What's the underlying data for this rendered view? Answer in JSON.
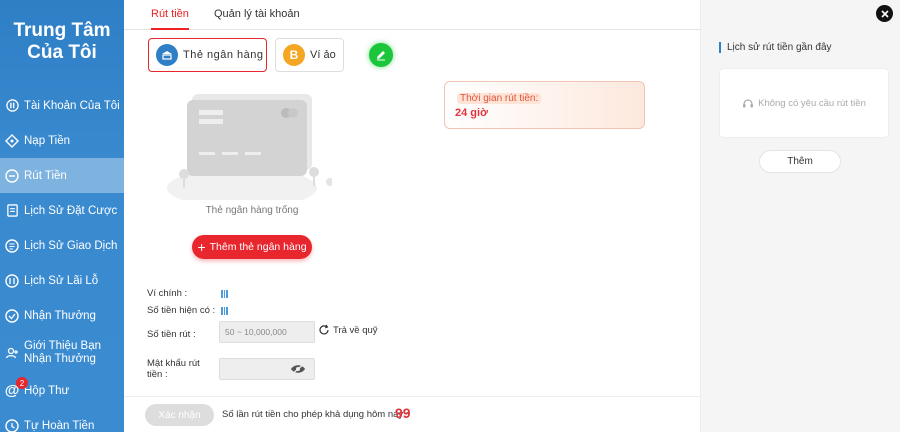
{
  "sidebar": {
    "title_line1": "Trung Tâm",
    "title_line2": "Của Tôi",
    "items": [
      {
        "label": "Tài Khoản Của Tôi",
        "icon": "account-icon"
      },
      {
        "label": "Nạp Tiền",
        "icon": "deposit-icon"
      },
      {
        "label": "Rút Tiền",
        "icon": "withdraw-icon"
      },
      {
        "label": "Lịch Sử Đặt Cược",
        "icon": "bet-history-icon"
      },
      {
        "label": "Lịch Sử Giao Dịch",
        "icon": "transaction-history-icon"
      },
      {
        "label": "Lịch Sử Lãi Lỗ",
        "icon": "profit-loss-icon"
      },
      {
        "label": "Nhận Thưởng",
        "icon": "reward-icon"
      },
      {
        "label": "Giới Thiệu Bạn Nhận Thưởng",
        "icon": "referral-icon"
      },
      {
        "label": "Hộp Thư",
        "icon": "mailbox-icon",
        "badge": "2"
      },
      {
        "label": "Tự Hoàn Tiền",
        "icon": "rebate-icon"
      }
    ],
    "active_index": 2
  },
  "tabs": [
    {
      "label": "Rút tiền",
      "active": true
    },
    {
      "label": "Quản lý tài khoản",
      "active": false
    }
  ],
  "methods": {
    "bank_label": "Thẻ ngân hàng",
    "wallet_label": "Ví ảo"
  },
  "bank": {
    "empty_label": "Thẻ ngân hàng trống",
    "add_label": "Thêm thẻ ngân hàng"
  },
  "info": {
    "time_label": "Thời gian rút tiền:",
    "time_value": "24 giờ"
  },
  "form": {
    "main_wallet_label": "Ví chính :",
    "available_label": "Số tiền hiện có :",
    "amount_label": "Số tiền rút :",
    "amount_placeholder": "50 ~ 10,000,000",
    "return_label": "Trả về quỹ",
    "password_label_line1": "Mật khẩu rút",
    "password_label_line2": "tiền :"
  },
  "footer": {
    "confirm_label": "Xác nhận",
    "remain_label": "Số lần rút tiền cho phép khả dụng hôm nay :",
    "remain_value": "99"
  },
  "history": {
    "title": "Lịch sử rút tiền gần đây",
    "empty_label": "Không có yêu cầu rút tiền",
    "more_label": "Thêm"
  },
  "colors": {
    "accent": "#e8262e",
    "sidebar": "#3a8ad0",
    "edit_button": "#1bc63b"
  }
}
